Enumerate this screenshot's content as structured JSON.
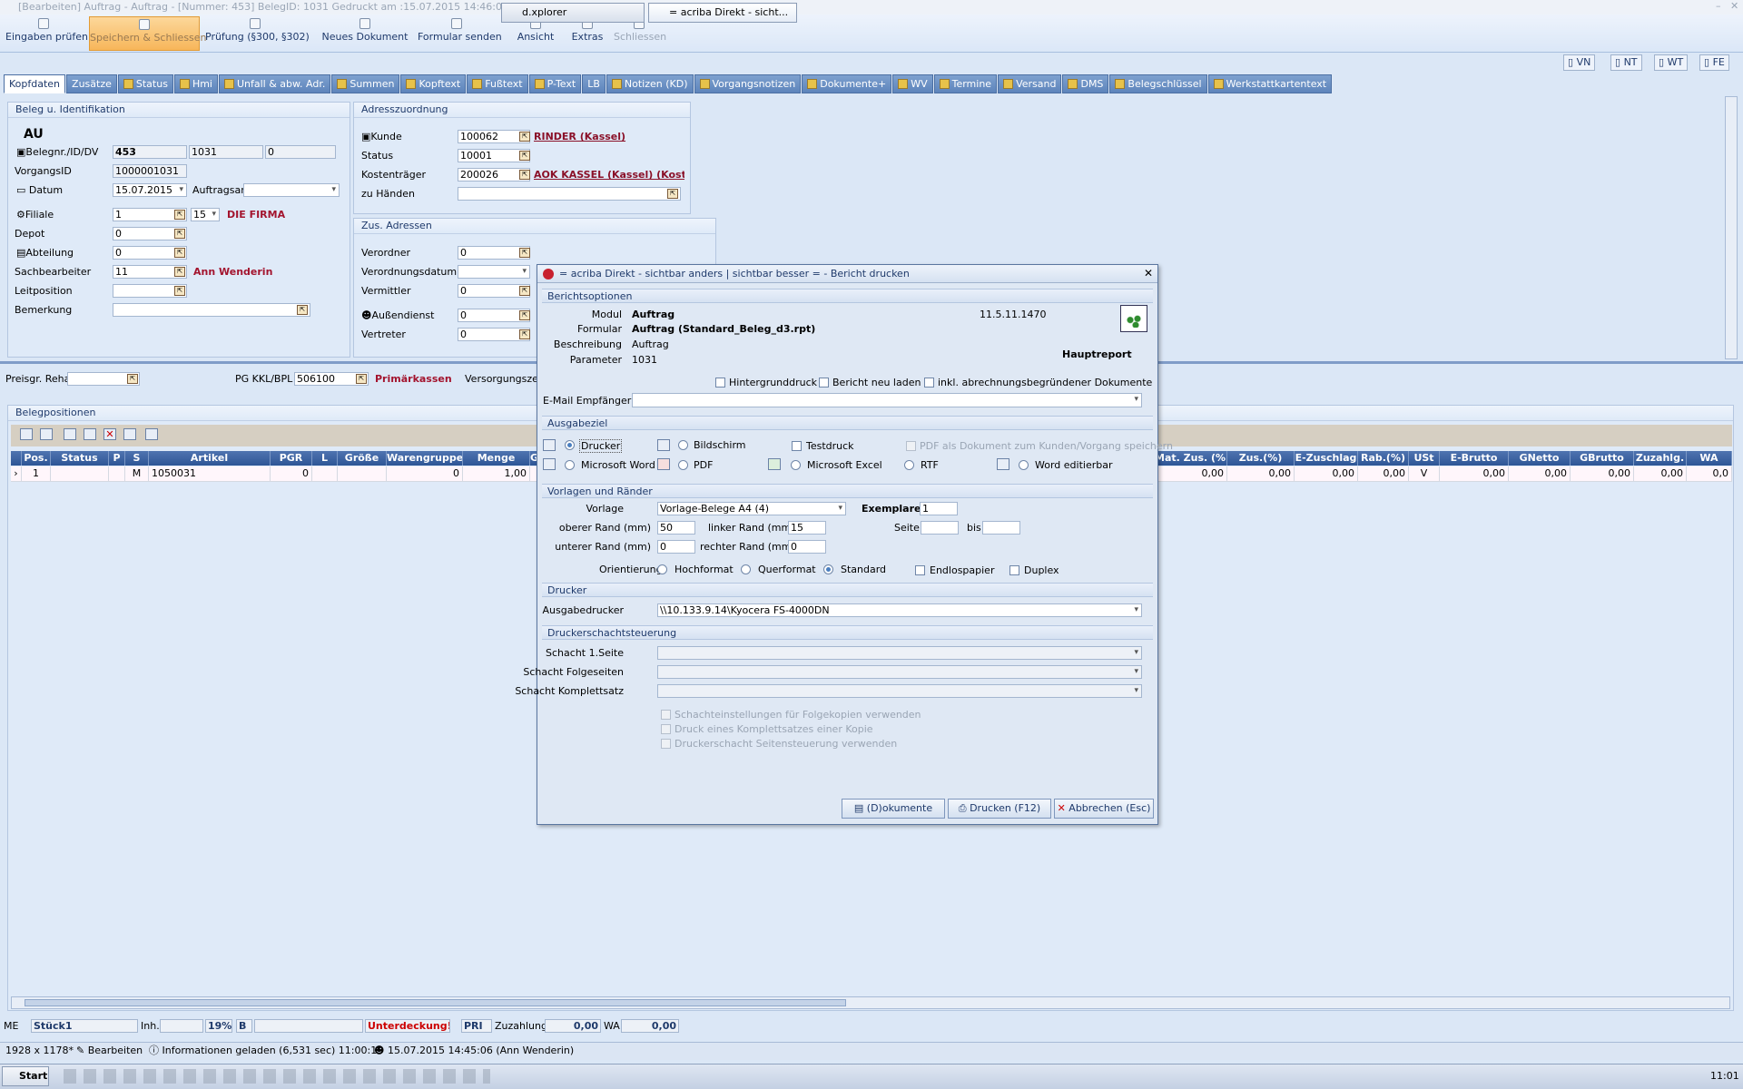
{
  "window": {
    "title": "[Bearbeiten] Auftrag - Auftrag - [Nummer: 453] BelegID: 1031  Gedruckt am :15.07.2015 14:46:04"
  },
  "ribbon": {
    "buttons": [
      "Eingaben prüfen",
      "Speichern & Schliessen",
      "Prüfung (§300, §302)",
      "Neues Dokument",
      "Formular senden",
      "Ansicht",
      "Extras",
      "Schliessen"
    ]
  },
  "corner_tabs": [
    "VN",
    "NT",
    "WT",
    "FE"
  ],
  "tabs": [
    "Kopfdaten",
    "Zusätze",
    "Status",
    "Hmi",
    "Unfall & abw. Adr.",
    "Summen",
    "Kopftext",
    "Fußtext",
    "P-Text",
    "LB",
    "Notizen (KD)",
    "Vorgangsnotizen",
    "Dokumente+",
    "WV",
    "Termine",
    "Versand",
    "DMS",
    "Belegschlüssel",
    "Werkstattkartentext"
  ],
  "beleg": {
    "header": "Beleg u. Identifikation",
    "type": "AU",
    "belegnr_label": "Belegnr./ID/DV",
    "belegnr": "453",
    "id": "1031",
    "dv": "0",
    "vorgang_label": "VorgangsID",
    "vorgang": "1000001031",
    "datum_label": "Datum",
    "datum": "15.07.2015",
    "auftragsart_label": "Auftragsart",
    "filiale_label": "Filiale",
    "filiale": "1",
    "filiale2": "15",
    "firma": "DIE FIRMA",
    "depot_label": "Depot",
    "depot": "0",
    "abteilung_label": "Abteilung",
    "abteilung": "0",
    "sach_label": "Sachbearbeiter",
    "sach": "11",
    "sach_name": "Ann Wenderin",
    "leit_label": "Leitposition",
    "bem_label": "Bemerkung"
  },
  "adresse": {
    "header": "Adresszuordnung",
    "kunde_label": "Kunde",
    "kunde": "100062",
    "kunde_name": "RINDER (Kassel)",
    "status_label": "Status",
    "status": "10001",
    "kost_label": "Kostenträger",
    "kost": "200026",
    "kost_name": "AOK KASSEL (Kassel) (Koste",
    "zuh_label": "zu Händen"
  },
  "zus": {
    "header": "Zus. Adressen",
    "verordner_label": "Verordner",
    "verordner": "0",
    "vdatum_label": "Verordnungsdatum",
    "vermittler_label": "Vermittler",
    "vermittler": "0",
    "aussen_label": "Außendienst",
    "aussen": "0",
    "vertreter_label": "Vertreter",
    "vertreter": "0"
  },
  "mid": {
    "preisgr_label": "Preisgr. Reha",
    "pg_label": "PG KKL/BPL",
    "pg": "506100",
    "pg_name": "Primärkassen",
    "versorgung_label": "Versorgungszeitr"
  },
  "positionen": {
    "header": "Belegpositionen",
    "cols_left": [
      "Pos.",
      "Status",
      "P",
      "S",
      "Artikel",
      "PGR",
      "L",
      "Größe",
      "Warengruppe",
      "Menge",
      "Ge"
    ],
    "row_left": [
      "1",
      "",
      "",
      "M",
      "1050031",
      "0",
      "",
      "",
      "0",
      "1,00",
      ""
    ],
    "cols_right": [
      "Mat. Zus. (%)",
      "Zus.(%)",
      "E-Zuschlag",
      "Rab.(%)",
      "USt",
      "E-Brutto",
      "GNetto",
      "GBrutto",
      "Zuzahlg.",
      "WA"
    ],
    "row_right": [
      "0,00",
      "0,00",
      "0,00",
      "0,00",
      "V",
      "0,00",
      "0,00",
      "0,00",
      "0,00",
      "0,0"
    ]
  },
  "footer": {
    "me": "ME",
    "stueck": "Stück1",
    "inh": "Inh.",
    "pct": "19%",
    "b": "B",
    "unter": "Unterdeckung!",
    "pri": "PRI",
    "zahl_label": "Zuzahlung",
    "zahl": "0,00",
    "wa_label": "WA",
    "wa": "0,00"
  },
  "status": {
    "size": "1928 x 1178*",
    "mode": "Bearbeiten",
    "info": "Informationen geladen (6,531 sec)  11:00:19",
    "user": "15.07.2015 14:45:06 (Ann Wenderin)"
  },
  "dialog": {
    "title": "= acriba Direkt - sichtbar anders | sichtbar besser = - Bericht drucken",
    "sec_optionen": "Berichtsoptionen",
    "modul_label": "Modul",
    "modul": "Auftrag",
    "version": "11.5.11.1470",
    "formular_label": "Formular",
    "formular": "Auftrag (Standard_Beleg_d3.rpt)",
    "beschr_label": "Beschreibung",
    "beschr": "Auftrag",
    "param_label": "Parameter",
    "param": "1031",
    "hauptreport": "Hauptreport",
    "chk_hintergrund": "Hintergrunddruck",
    "chk_neu": "Bericht neu laden",
    "chk_inkl": "inkl. abrechnungsbegründener Dokumente",
    "email_label": "E-Mail Empfänger",
    "sec_ausgabe": "Ausgabeziel",
    "opt_drucker": "Drucker",
    "opt_bildschirm": "Bildschirm",
    "opt_testdruck": "Testdruck",
    "opt_pdfdok": "PDF als Dokument zum Kunden/Vorgang speichern",
    "opt_word": "Microsoft Word",
    "opt_pdf": "PDF",
    "opt_excel": "Microsoft Excel",
    "opt_rtf": "RTF",
    "opt_wordedit": "Word editierbar",
    "sec_vorlagen": "Vorlagen und Ränder",
    "vorlage_label": "Vorlage",
    "vorlage": "Vorlage-Belege A4 (4)",
    "exemplare_label": "Exemplare",
    "exemplare": "1",
    "oben_label": "oberer Rand (mm)",
    "oben": "50",
    "links_label": "linker Rand (mm)",
    "links": "15",
    "seite_label": "Seite",
    "bis_label": "bis",
    "unten_label": "unterer Rand (mm)",
    "unten": "0",
    "rechts_label": "rechter Rand (mm)",
    "rechts": "0",
    "orient_label": "Orientierung",
    "hoch": "Hochformat",
    "quer": "Querformat",
    "standard": "Standard",
    "endlos": "Endlospapier",
    "duplex": "Duplex",
    "sec_drucker": "Drucker",
    "ausgabe_label": "Ausgabedrucker",
    "ausgabe": "\\\\10.133.9.14\\Kyocera FS-4000DN",
    "sec_schacht": "Druckerschachtsteuerung",
    "schacht1": "Schacht 1.Seite",
    "schachtf": "Schacht Folgeseiten",
    "schachtk": "Schacht Komplettsatz",
    "c1": "Schachteinstellungen für Folgekopien verwenden",
    "c2": "Druck eines Komplettsatzes einer Kopie",
    "c3": "Druckerschacht Seitensteuerung verwenden",
    "btn_dok": "(D)okumente",
    "btn_druck": "Drucken (F12)",
    "btn_abbr": "Abbrechen (Esc)"
  },
  "taskbar": {
    "start": "Start",
    "t1": "d.xplorer",
    "t2": "= acriba Direkt - sicht...",
    "clock": "11:01"
  }
}
